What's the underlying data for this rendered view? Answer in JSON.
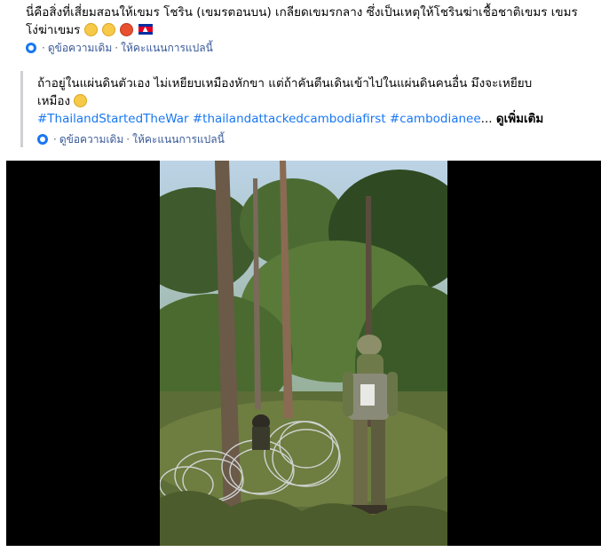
{
  "post": {
    "text_line1": "นี่คือสิ่งที่เสี่ยมสอนให้เขมร โชริน (เขมรตอนบน) เกลียดเขมรกลาง ซึ่งเป็นเหตุให้โชรินฆ่าเชื้อชาติเขมร เขมร",
    "text_line2": "โง่ฆ่าเขมร",
    "emojis": [
      "grimacing-face",
      "pensive-face",
      "angry-face",
      "cambodia-flag"
    ]
  },
  "translation_meta_1": {
    "see_original": "ดูข้อความเดิม",
    "separator": "·",
    "rate_translation": "ให้คะแนนการแปลนี้"
  },
  "quoted": {
    "text_line1": "ถ้าอยู่ในแผ่นดินตัวเอง ไม่เหยียบเหมืองหักขา แต่ถ้าคันตีนเดินเข้าไปในแผ่นดินคนอื่น มึงจะเหยียบ",
    "text_line2": "เหมือง",
    "emoji": "grinning-face",
    "hashtag1": "#ThailandStartedTheWar",
    "hashtag2": "#thailandattackedcambodiafirst",
    "hashtag3": "#cambodianee",
    "ellipsis": "...",
    "see_more": "ดูเพิ่มเติม"
  },
  "translation_meta_2": {
    "see_original": "ดูข้อความเดิม",
    "separator": "·",
    "rate_translation": "ให้คะแนนการแปลนี้"
  },
  "video": {
    "description": "soldier-in-forest-with-razor-wire"
  },
  "colors": {
    "link": "#385898",
    "hashtag": "#1877f2",
    "quote_bar": "#ced0d4",
    "video_bg": "#000000"
  }
}
